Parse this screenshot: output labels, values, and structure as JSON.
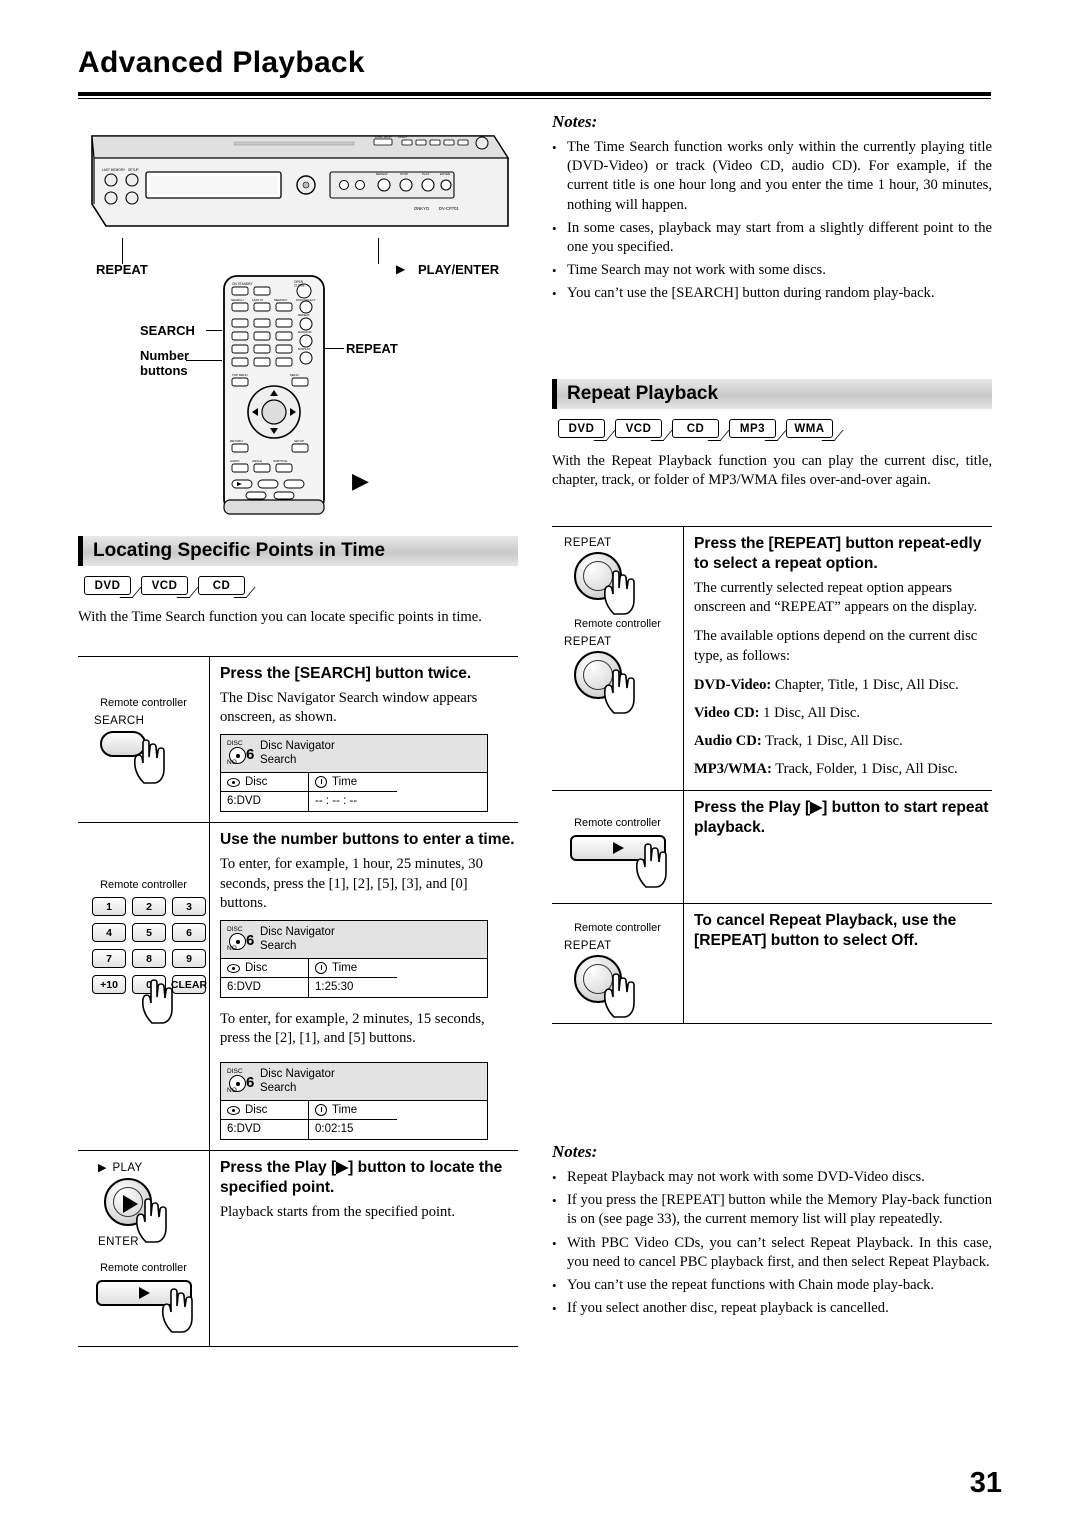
{
  "page": {
    "title": "Advanced Playback",
    "number": "31"
  },
  "notes_top": {
    "heading": "Notes:",
    "items": [
      "The Time Search function works only within the currently playing title (DVD-Video) or track (Video CD, audio CD). For example, if the current title is one hour long and you enter the time 1 hour, 30 minutes, nothing will happen.",
      "In some cases, playback may start from a slightly different point to the one you specified.",
      "Time Search may not work with some discs.",
      "You can’t use the [SEARCH] button during random play-back."
    ]
  },
  "diagram": {
    "labels": {
      "repeat_left": "REPEAT",
      "play_enter": "PLAY/ENTER",
      "search": "SEARCH",
      "number_buttons_line1": "Number",
      "number_buttons_line2": "buttons",
      "repeat_right": "REPEAT"
    },
    "player_text": "Onkyo DV-CP701"
  },
  "locating": {
    "bar_title": "Locating Specific Points in Time",
    "badges": [
      "DVD",
      "VCD",
      "CD"
    ],
    "intro": "With the Time Search function you can locate specific points in time.",
    "steps": [
      {
        "head": "Press the [SEARCH] button twice.",
        "body": "The Disc Navigator Search window appears onscreen, as shown.",
        "rc_label": "Remote controller",
        "btn_label": "SEARCH"
      },
      {
        "head": "Use the number buttons to enter a time.",
        "body1": "To enter, for example, 1 hour, 25 minutes, 30 seconds, press the [1], [2], [5], [3], and [0] buttons.",
        "body2": "To enter, for example, 2 minutes, 15 seconds, press the [2], [1], and [5] buttons.",
        "rc_label": "Remote controller",
        "keys": [
          "1",
          "2",
          "3",
          "4",
          "5",
          "6",
          "7",
          "8",
          "9",
          "+10",
          "0",
          "CLEAR"
        ]
      },
      {
        "head": "Press the Play [▶] button to locate the specified point.",
        "body": "Playback starts from the specified point.",
        "btn_label": "PLAY",
        "btn_label2": "ENTER",
        "rc_label": "Remote controller"
      }
    ],
    "navigator": [
      {
        "title": "Disc Navigator",
        "subtitle": "Search",
        "num": "6",
        "ico_top": "DISC",
        "ico_bottom": "NO.",
        "f1_label": "Disc",
        "f1_value": "6:DVD",
        "f2_label": "Time",
        "f2_value": "-- : -- : --"
      },
      {
        "title": "Disc Navigator",
        "subtitle": "Search",
        "num": "6",
        "ico_top": "DISC",
        "ico_bottom": "NO.",
        "f1_label": "Disc",
        "f1_value": "6:DVD",
        "f2_label": "Time",
        "f2_value": "1:25:30"
      },
      {
        "title": "Disc Navigator",
        "subtitle": "Search",
        "num": "6",
        "ico_top": "DISC",
        "ico_bottom": "NO.",
        "f1_label": "Disc",
        "f1_value": "6:DVD",
        "f2_label": "Time",
        "f2_value": "0:02:15"
      }
    ]
  },
  "repeat": {
    "bar_title": "Repeat Playback",
    "badges": [
      "DVD",
      "VCD",
      "CD",
      "MP3",
      "WMA"
    ],
    "intro": "With the Repeat Playback function you can play the current disc, title, chapter, track, or folder of MP3/WMA files over-and-over again.",
    "steps": [
      {
        "head": "Press the [REPEAT] button repeat-edly to select a repeat option.",
        "body1": "The currently selected repeat option appears onscreen and “REPEAT” appears on the display.",
        "body2": "The available options depend on the current disc type, as follows:",
        "options": [
          {
            "label": "DVD-Video:",
            "value": " Chapter, Title, 1 Disc, All Disc."
          },
          {
            "label": "Video CD:",
            "value": " 1 Disc, All Disc."
          },
          {
            "label": "Audio CD:",
            "value": " Track, 1 Disc, All Disc."
          },
          {
            "label": "MP3/WMA:",
            "value": " Track, Folder, 1 Disc, All Disc."
          }
        ],
        "btn_label": "REPEAT",
        "rc_label": "Remote controller",
        "btn_label2": "REPEAT"
      },
      {
        "head": "Press the Play [▶] button to start repeat playback.",
        "rc_label": "Remote controller"
      },
      {
        "head": "To cancel Repeat Playback, use the [REPEAT] button to select Off.",
        "rc_label": "Remote controller",
        "btn_label": "REPEAT"
      }
    ],
    "notes_heading": "Notes:",
    "notes": [
      "Repeat Playback may not work with some DVD-Video discs.",
      "If you press the [REPEAT] button while the Memory Play-back function is on (see page 33), the current memory list will play repeatedly.",
      "With PBC Video CDs, you can’t select Repeat Playback. In this case, you need to cancel PBC playback first, and then select Repeat Playback.",
      "You can’t use the repeat functions with Chain mode play-back.",
      "If you select another disc, repeat playback is cancelled."
    ]
  }
}
